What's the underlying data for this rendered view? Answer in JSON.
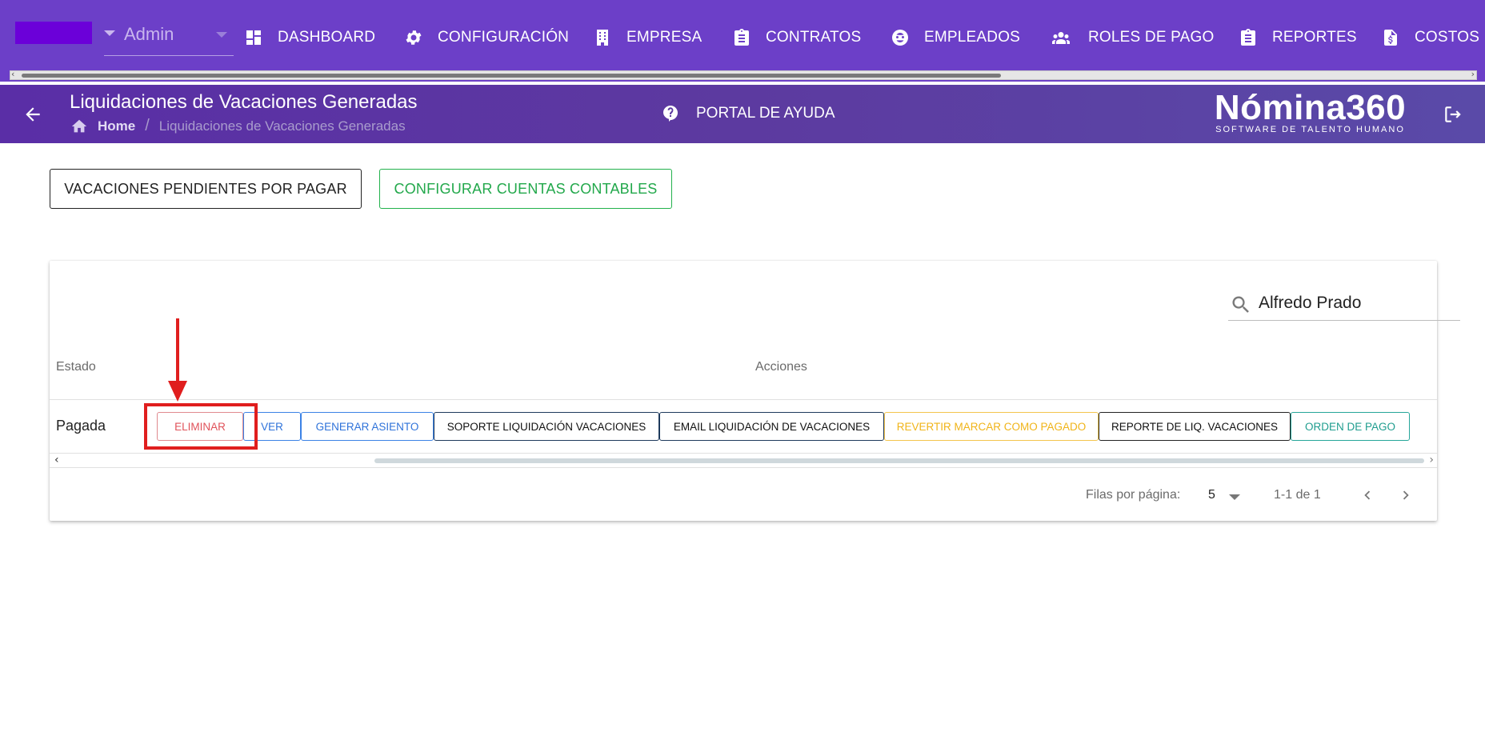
{
  "app": {
    "role_selector": {
      "value": "Admin"
    }
  },
  "nav": {
    "items": [
      {
        "label": "DASHBOARD",
        "icon": "dashboard-icon"
      },
      {
        "label": "CONFIGURACIÓN",
        "icon": "gear-icon"
      },
      {
        "label": "EMPRESA",
        "icon": "building-icon"
      },
      {
        "label": "CONTRATOS",
        "icon": "clipboard-icon"
      },
      {
        "label": "EMPLEADOS",
        "icon": "face-icon"
      },
      {
        "label": "ROLES DE PAGO",
        "icon": "people-icon"
      },
      {
        "label": "REPORTES",
        "icon": "clipboard-list-icon"
      },
      {
        "label": "COSTOS",
        "icon": "invoice-dollar-icon"
      }
    ]
  },
  "header": {
    "title": "Liquidaciones de Vacaciones Generadas",
    "breadcrumb": {
      "home": "Home",
      "separator": "/",
      "current": "Liquidaciones de Vacaciones Generadas"
    },
    "help_label": "PORTAL DE AYUDA",
    "logo_main": "Nómina360",
    "logo_sub": "SOFTWARE DE TALENTO HUMANO"
  },
  "actions": {
    "pending_label": "VACACIONES PENDIENTES POR PAGAR",
    "config_label": "CONFIGURAR CUENTAS CONTABLES"
  },
  "table": {
    "search_value": "Alfredo Prado",
    "headers": {
      "estado": "Estado",
      "acciones": "Acciones"
    },
    "rows": [
      {
        "estado": "Pagada",
        "buttons": {
          "eliminar": "ELIMINAR",
          "ver": "VER",
          "asiento": "GENERAR ASIENTO",
          "soporte": "SOPORTE LIQUIDACIÓN VACACIONES",
          "email": "EMAIL LIQUIDACIÓN DE VACACIONES",
          "revertir": "REVERTIR MARCAR COMO PAGADO",
          "reporte": "REPORTE DE LIQ. VACACIONES",
          "orden": "ORDEN DE PAGO"
        }
      }
    ],
    "pagination": {
      "rows_label": "Filas por página:",
      "rows_value": "5",
      "range": "1-1 de 1"
    }
  },
  "colors": {
    "topnav": "#6c3fc8",
    "header": "#5a2ea6",
    "highlight": "#e01e1e"
  }
}
